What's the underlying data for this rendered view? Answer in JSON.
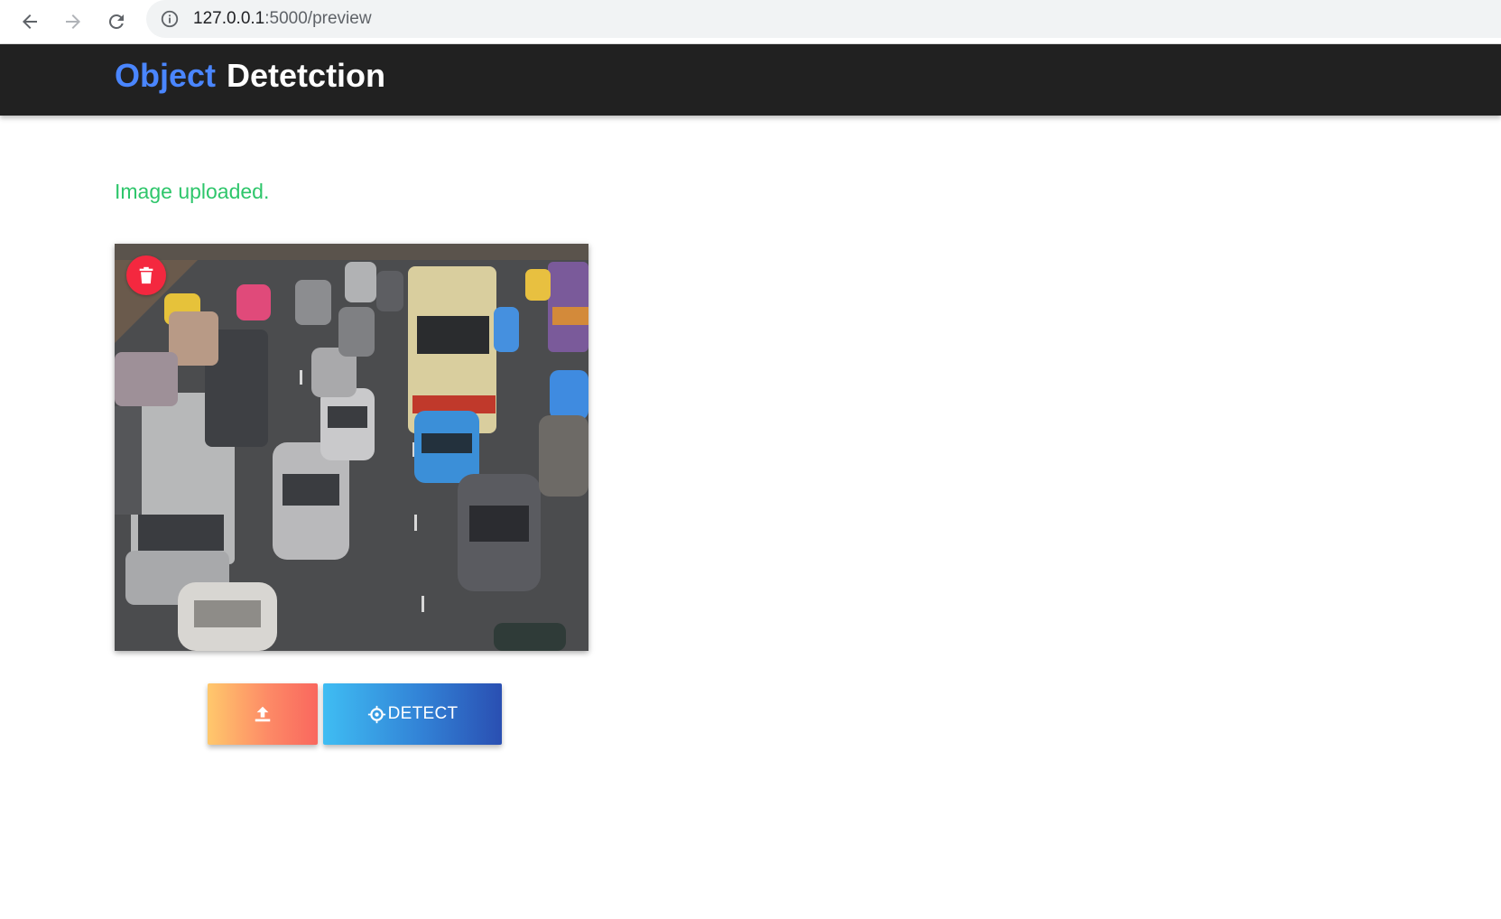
{
  "browser": {
    "url_host": "127.0.0.1",
    "url_path": ":5000/preview",
    "icons": [
      "back-arrow-icon",
      "forward-arrow-icon",
      "reload-icon",
      "info-icon"
    ]
  },
  "navbar": {
    "brand_part1": "Object",
    "brand_part2": "Detetction",
    "brand_accent_color": "#4a86ff",
    "background_color": "#212121"
  },
  "main": {
    "status_message": "Image uploaded.",
    "status_color": "#2ec66b",
    "preview_image": {
      "alt": "uploaded traffic photo",
      "delete_icon": "trash-icon",
      "delete_color": "#f4283f"
    },
    "buttons": {
      "upload_icon": "upload-icon",
      "detect_icon": "crosshair-icon",
      "detect_label": "DETECT"
    }
  }
}
